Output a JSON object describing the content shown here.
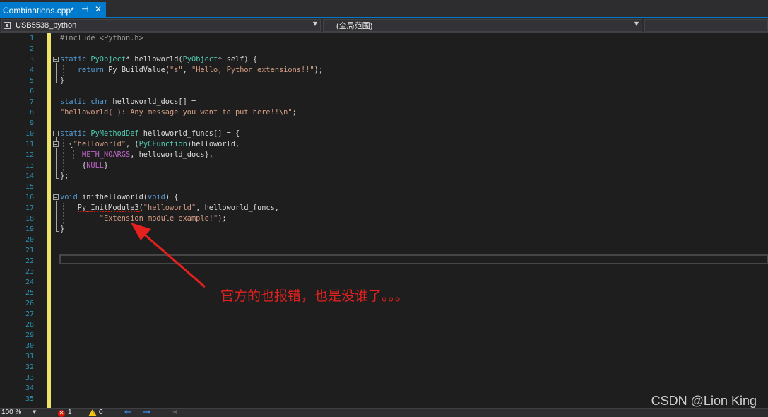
{
  "tab": {
    "title": "Combinations.cpp*",
    "pin_glyph": "⊣",
    "close_glyph": "✕"
  },
  "navbar": {
    "project": "USB5538_python",
    "scope": "(全局范围)",
    "member": ""
  },
  "editor": {
    "line_numbers": [
      "1",
      "2",
      "3",
      "4",
      "5",
      "6",
      "7",
      "8",
      "9",
      "10",
      "11",
      "12",
      "13",
      "14",
      "15",
      "16",
      "17",
      "18",
      "19",
      "20",
      "21",
      "22",
      "23",
      "24",
      "25",
      "26",
      "27",
      "28",
      "29",
      "30",
      "31",
      "32",
      "33",
      "34",
      "35"
    ],
    "lines": [
      "#include <Python.h>",
      "",
      "static PyObject* helloworld(PyObject* self) {",
      "    return Py_BuildValue(\"s\", \"Hello, Python extensions!!\");",
      "}",
      "",
      "static char helloworld_docs[] =",
      "\"helloworld( ): Any message you want to put here!!\\n\";",
      "",
      "static PyMethodDef helloworld_funcs[] = {",
      "  {\"helloworld\", (PyCFunction)helloworld,",
      "     METH_NOARGS, helloworld_docs},",
      "     {NULL}",
      "};",
      "",
      "void inithelloworld(void) {",
      "    Py_InitModule3(\"helloworld\", helloworld_funcs,",
      "         \"Extension module example!\");",
      "}"
    ]
  },
  "annotation": {
    "text": "官方的也报错，也是没谁了。。。",
    "color": "#e5211f"
  },
  "watermark": "CSDN @Lion King",
  "statusbar": {
    "zoom": "100 %",
    "errors": "1",
    "warnings": "0"
  },
  "colors": {
    "accent": "#007acc",
    "keyword": "#569cd6",
    "type": "#4ec9b0",
    "string": "#d69d85",
    "line_number": "#2b91af",
    "change_bar": "#efe465",
    "error": "#e51400"
  },
  "icons": {
    "tab_pin": "pin-icon",
    "tab_close": "close-icon",
    "project": "project-icon",
    "error": "error-icon",
    "warning": "warning-icon",
    "back": "arrow-left-icon",
    "forward": "arrow-right-icon"
  }
}
